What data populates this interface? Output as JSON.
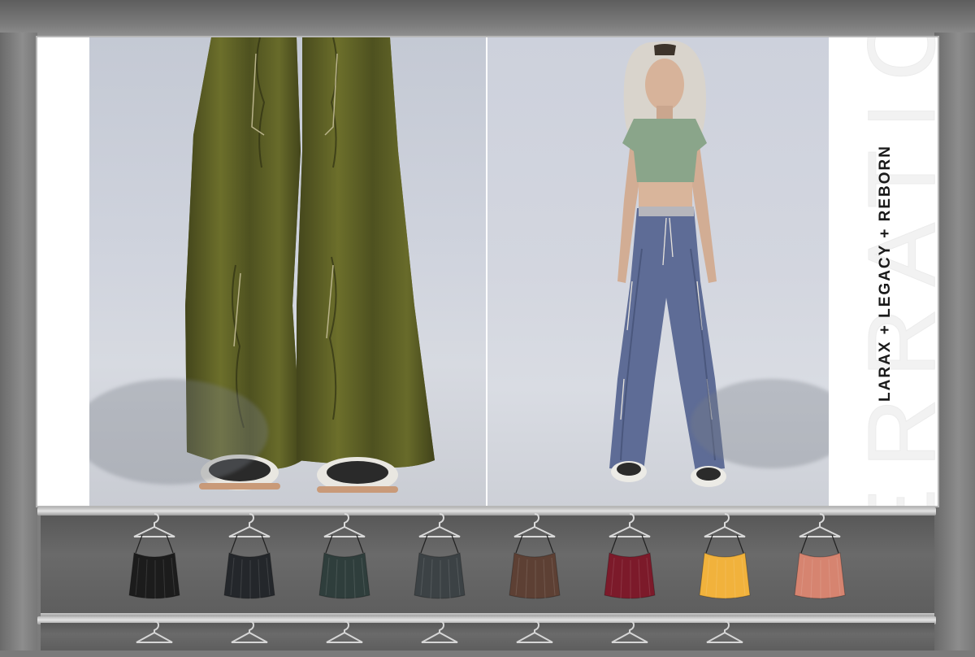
{
  "poster": {
    "brand": "ERRATIC",
    "compatibility": "LARAX + LEGACY + REBORN"
  },
  "colors": {
    "pants_olive": "#5b5e24",
    "pants_blue": "#5e6c96",
    "top_green": "#8aa58a"
  },
  "shelf": {
    "swatches": [
      {
        "color": "#1c1c1c"
      },
      {
        "color": "#24272b"
      },
      {
        "color": "#2f3e3c"
      },
      {
        "color": "#3c4245"
      },
      {
        "color": "#5d4034"
      },
      {
        "color": "#7c1a2a"
      },
      {
        "color": "#f1b23c"
      },
      {
        "color": "#d68470"
      }
    ]
  }
}
